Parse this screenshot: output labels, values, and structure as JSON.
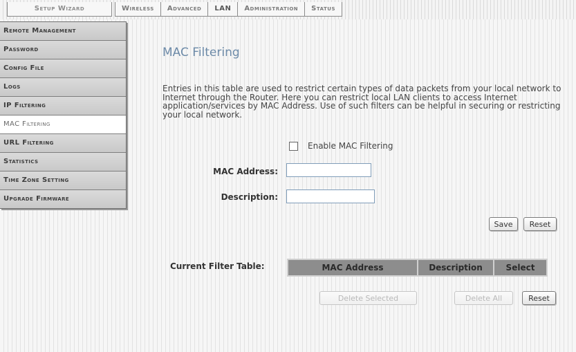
{
  "topnav": {
    "tabs": [
      {
        "label": "Setup Wizard"
      },
      {
        "label": "Wireless"
      },
      {
        "label": "Advanced"
      },
      {
        "label": "LAN"
      },
      {
        "label": "Administration"
      },
      {
        "label": "Status"
      }
    ]
  },
  "sidebar": {
    "items": [
      {
        "label": "Remote Management"
      },
      {
        "label": "Password"
      },
      {
        "label": "Config File"
      },
      {
        "label": "Logs"
      },
      {
        "label": "IP Filtering"
      },
      {
        "label": "MAC Filtering",
        "active": true
      },
      {
        "label": "URL Filtering"
      },
      {
        "label": "Statistics"
      },
      {
        "label": "Time Zone Setting"
      },
      {
        "label": "Upgrade Firmware"
      }
    ]
  },
  "main": {
    "title": "MAC Filtering",
    "description": "Entries in this table are used to restrict certain types of data packets from your local network to Internet through the Router. Here you can restrict local LAN clients to access Internet application/services by MAC Address. Use of such filters can be helpful in securing or restricting your local network.",
    "enable_label": "Enable MAC Filtering",
    "enable_checked": false,
    "mac_label": "MAC Address:",
    "mac_value": "",
    "desc_label": "Description:",
    "desc_value": "",
    "save_label": "Save",
    "reset_label": "Reset",
    "table_label": "Current Filter Table:",
    "table_headers": [
      "MAC Address",
      "Description",
      "Select"
    ],
    "delete_selected_label": "Delete Selected",
    "delete_all_label": "Delete All",
    "reset2_label": "Reset"
  },
  "colors": {
    "title": "#6c8aa8",
    "sidebar_bg": "#cfcfcf",
    "table_header_bg": "#8d8d8d"
  }
}
